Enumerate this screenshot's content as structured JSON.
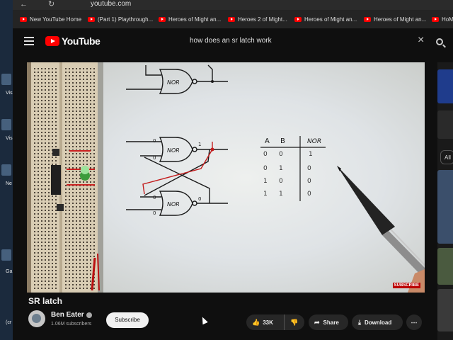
{
  "browser": {
    "url": "youtube.com",
    "bookmarks": [
      {
        "label": "New YouTube Home"
      },
      {
        "label": "(Part 1) Playthrough..."
      },
      {
        "label": "Heroes of Might an..."
      },
      {
        "label": "Heroes 2 of Might..."
      },
      {
        "label": "Heroes of Might an..."
      },
      {
        "label": "Heroes of Might an..."
      },
      {
        "label": "HoM"
      }
    ]
  },
  "desktop": {
    "labels": [
      "Vis",
      "Vis",
      "Ne",
      "Ga",
      "(cr"
    ]
  },
  "header": {
    "logo_text": "YouTube",
    "search_query": "how does an sr latch work"
  },
  "video": {
    "gate_label": "NOR",
    "truth_table": {
      "headers": [
        "A",
        "B",
        "NOR"
      ],
      "rows": [
        [
          "0",
          "0",
          "1"
        ],
        [
          "0",
          "1",
          "0"
        ],
        [
          "1",
          "0",
          "0"
        ],
        [
          "1",
          "1",
          "0"
        ]
      ]
    },
    "watermark": "SUBSCRIBE"
  },
  "right_panel": {
    "chip_label": "All"
  },
  "meta": {
    "title": "SR latch",
    "channel_name": "Ben Eater",
    "subscribers": "1.06M subscribers",
    "subscribe_label": "Subscribe",
    "likes": "33K",
    "share_label": "Share",
    "download_label": "Download"
  },
  "colors": {
    "background": "#0f0f0f",
    "brand_red": "#ff0000",
    "pill": "#272727"
  }
}
